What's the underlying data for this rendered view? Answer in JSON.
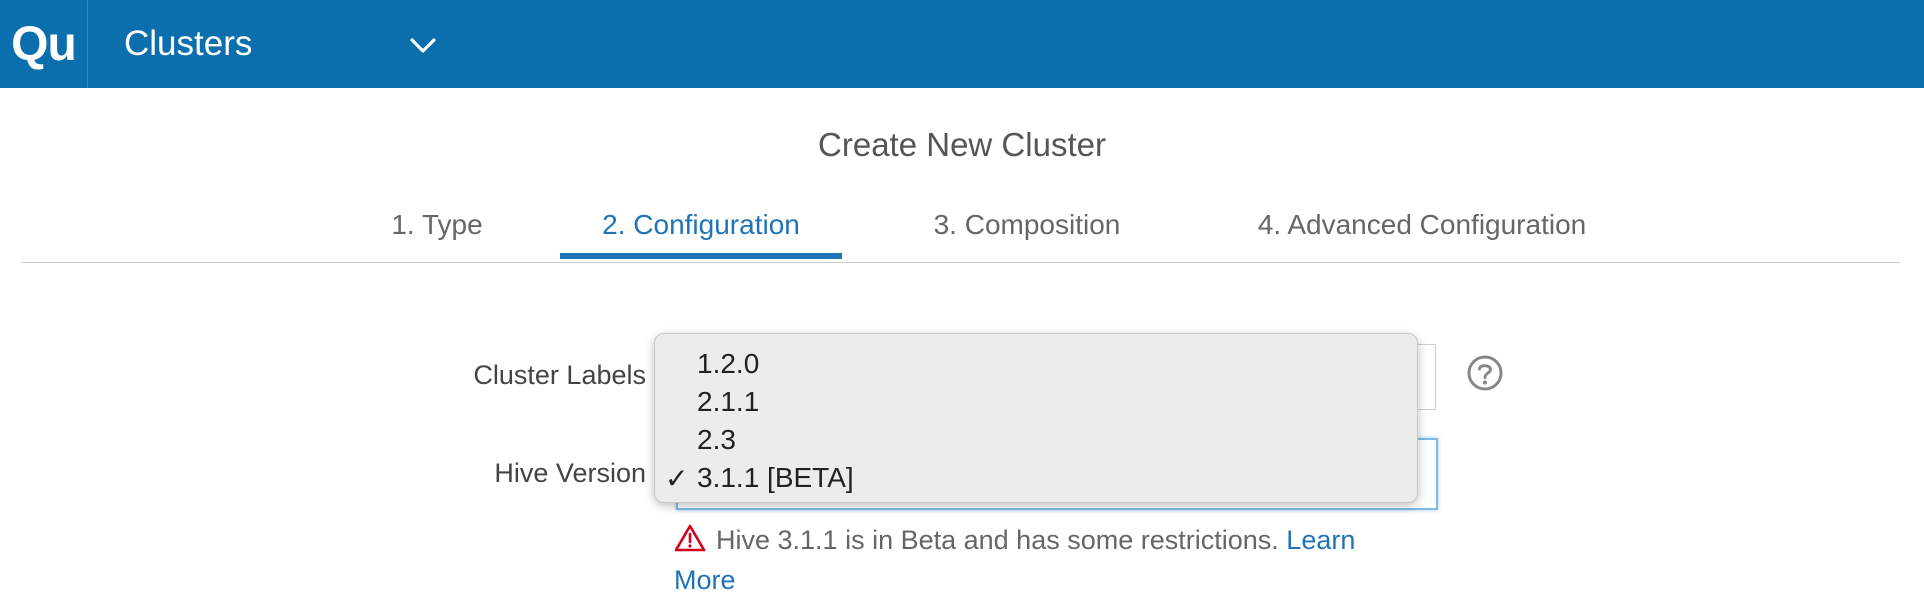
{
  "header": {
    "logo_text": "Qu",
    "app_title": "Clusters",
    "brand_color": "#0c6fad"
  },
  "page": {
    "title": "Create New Cluster"
  },
  "tabs": [
    {
      "label": "1. Type",
      "active": false
    },
    {
      "label": "2. Configuration",
      "active": true
    },
    {
      "label": "3. Composition",
      "active": false
    },
    {
      "label": "4. Advanced Configuration",
      "active": false
    }
  ],
  "form": {
    "cluster_labels_label": "Cluster Labels",
    "hive_version_label": "Hive Version",
    "hive_version_selected": "3.1.1 [BETA]",
    "hive_version_options": [
      {
        "label": "1.2.0",
        "checked": false
      },
      {
        "label": "2.1.1",
        "checked": false
      },
      {
        "label": "2.3",
        "checked": false
      },
      {
        "label": "3.1.1 [BETA]",
        "checked": true
      }
    ],
    "check_mark": "✓"
  },
  "warning": {
    "text": "Hive 3.1.1 is in Beta and has some restrictions.",
    "link": "Learn More",
    "color": "#d0021b"
  },
  "icons": {
    "help": "question-circle-icon",
    "warning": "warning-triangle-icon",
    "dropdown": "chevron-down-icon"
  }
}
